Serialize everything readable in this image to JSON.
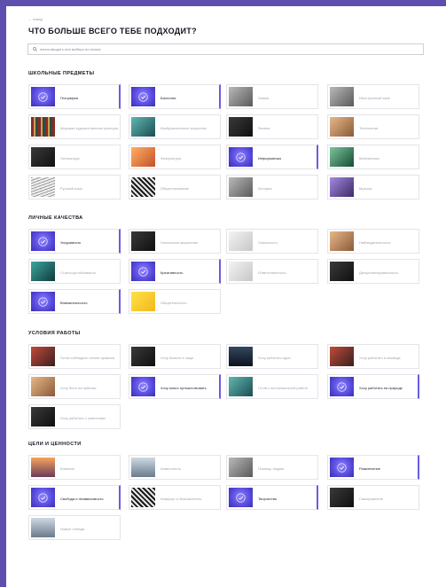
{
  "header": {
    "back": "← назад",
    "title": "ЧТО БОЛЬШЕ ВСЕГО ТЕБЕ ПОДХОДИТ?"
  },
  "search": {
    "placeholder": "начни вводить или выбери из списка"
  },
  "sections": [
    {
      "title": "ШКОЛЬНЫЕ ПРЕДМЕТЫ",
      "items": [
        {
          "label": "География",
          "selected": true,
          "thumb": "t-sel"
        },
        {
          "label": "Биология",
          "selected": true,
          "thumb": "t-sel"
        },
        {
          "label": "Химия",
          "selected": false,
          "thumb": "t-gray"
        },
        {
          "label": "Иностранный язык",
          "selected": false,
          "thumb": "t-gray"
        },
        {
          "label": "Мировая художественная культура",
          "selected": false,
          "thumb": "t-books"
        },
        {
          "label": "Изобразительное искусство",
          "selected": false,
          "thumb": "t-teal"
        },
        {
          "label": "Физика",
          "selected": false,
          "thumb": "t-dark"
        },
        {
          "label": "Технология",
          "selected": false,
          "thumb": "t-warm"
        },
        {
          "label": "Литература",
          "selected": false,
          "thumb": "t-dark"
        },
        {
          "label": "Физкультура",
          "selected": false,
          "thumb": "t-orange"
        },
        {
          "label": "Информатика",
          "selected": true,
          "thumb": "t-sel"
        },
        {
          "label": "Математика",
          "selected": false,
          "thumb": "t-green"
        },
        {
          "label": "Русский язык",
          "selected": false,
          "thumb": "t-wave"
        },
        {
          "label": "Обществознание",
          "selected": false,
          "thumb": "t-stripe"
        },
        {
          "label": "История",
          "selected": false,
          "thumb": "t-gray"
        },
        {
          "label": "Музыка",
          "selected": false,
          "thumb": "t-purple"
        }
      ]
    },
    {
      "title": "ЛИЧНЫЕ КАЧЕСТВА",
      "items": [
        {
          "label": "Усидчивость",
          "selected": true,
          "thumb": "t-sel"
        },
        {
          "label": "Логическое мышление",
          "selected": false,
          "thumb": "t-dark"
        },
        {
          "label": "Лояльность",
          "selected": false,
          "thumb": "t-light"
        },
        {
          "label": "Наблюдательность",
          "selected": false,
          "thumb": "t-warm"
        },
        {
          "label": "Стрессоустойчивость",
          "selected": false,
          "thumb": "t-cyan"
        },
        {
          "label": "Креативность",
          "selected": true,
          "thumb": "t-sel"
        },
        {
          "label": "Ответственность",
          "selected": false,
          "thumb": "t-light"
        },
        {
          "label": "Дисциплинированность",
          "selected": false,
          "thumb": "t-dark"
        },
        {
          "label": "Внимательность",
          "selected": true,
          "thumb": "t-sel"
        },
        {
          "label": "Общительность",
          "selected": false,
          "thumb": "t-yellow"
        }
      ]
    },
    {
      "title": "УСЛОВИЯ РАБОТЫ",
      "items": [
        {
          "label": "Готов соблюдать четкие правила",
          "selected": false,
          "thumb": "t-red"
        },
        {
          "label": "Хочу бывать в чаще",
          "selected": false,
          "thumb": "t-dark"
        },
        {
          "label": "Хочу работать один",
          "selected": false,
          "thumb": "t-night"
        },
        {
          "label": "Хочу работать в команде",
          "selected": false,
          "thumb": "t-red"
        },
        {
          "label": "Хочу быть на публике",
          "selected": false,
          "thumb": "t-warm"
        },
        {
          "label": "Хочу много путешествовать",
          "selected": true,
          "thumb": "t-sel"
        },
        {
          "label": "Готов к экстремальной работе",
          "selected": false,
          "thumb": "t-teal"
        },
        {
          "label": "Хочу работать на природе",
          "selected": true,
          "thumb": "t-sel"
        },
        {
          "label": "Хочу работать с клиентами",
          "selected": false,
          "thumb": "t-dark"
        }
      ]
    },
    {
      "title": "ЦЕЛИ И ЦЕННОСТИ",
      "items": [
        {
          "label": "Влияние",
          "selected": false,
          "thumb": "t-sunset"
        },
        {
          "label": "Известность",
          "selected": false,
          "thumb": "t-sky"
        },
        {
          "label": "Помощь людям",
          "selected": false,
          "thumb": "t-gray"
        },
        {
          "label": "Развлечение",
          "selected": true,
          "thumb": "t-sel"
        },
        {
          "label": "Свобода и независимость",
          "selected": true,
          "thumb": "t-sel"
        },
        {
          "label": "Комфорт и безопасность",
          "selected": false,
          "thumb": "t-stripe"
        },
        {
          "label": "Творчество",
          "selected": true,
          "thumb": "t-sel"
        },
        {
          "label": "Саморазвитие",
          "selected": false,
          "thumb": "t-dark"
        },
        {
          "label": "Новые победы",
          "selected": false,
          "thumb": "t-sky"
        }
      ]
    }
  ]
}
